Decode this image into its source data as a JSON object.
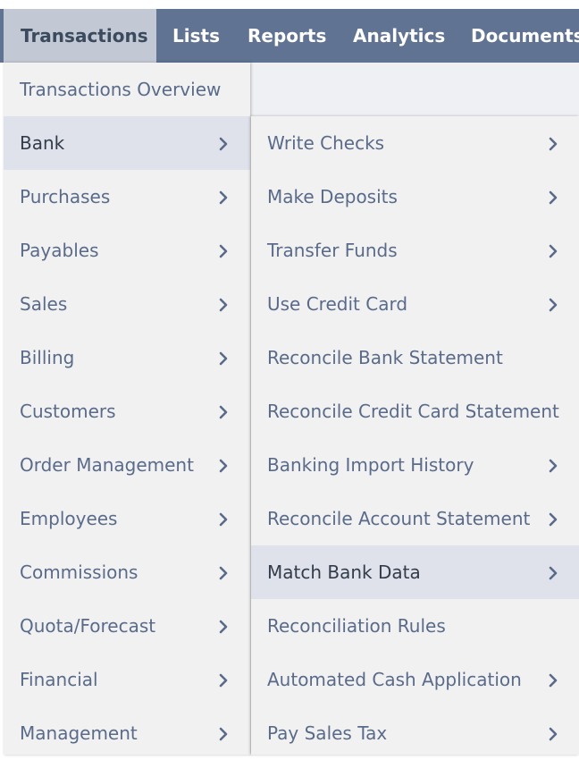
{
  "nav": {
    "tabs": [
      {
        "label": "Transactions",
        "active": true
      },
      {
        "label": "Lists",
        "active": false
      },
      {
        "label": "Reports",
        "active": false
      },
      {
        "label": "Analytics",
        "active": false
      },
      {
        "label": "Documents",
        "active": false
      }
    ]
  },
  "menu": {
    "items": [
      {
        "label": "Transactions Overview",
        "submenu": false
      },
      {
        "label": "Bank",
        "submenu": true,
        "highlighted": true
      },
      {
        "label": "Purchases",
        "submenu": true
      },
      {
        "label": "Payables",
        "submenu": true
      },
      {
        "label": "Sales",
        "submenu": true
      },
      {
        "label": "Billing",
        "submenu": true
      },
      {
        "label": "Customers",
        "submenu": true
      },
      {
        "label": "Order Management",
        "submenu": true
      },
      {
        "label": "Employees",
        "submenu": true
      },
      {
        "label": "Commissions",
        "submenu": true
      },
      {
        "label": "Quota/Forecast",
        "submenu": true
      },
      {
        "label": "Financial",
        "submenu": true
      },
      {
        "label": "Management",
        "submenu": true
      }
    ]
  },
  "submenu": {
    "items": [
      {
        "label": "Write Checks",
        "submenu": true
      },
      {
        "label": "Make Deposits",
        "submenu": true
      },
      {
        "label": "Transfer Funds",
        "submenu": true
      },
      {
        "label": "Use Credit Card",
        "submenu": true
      },
      {
        "label": "Reconcile Bank Statement",
        "submenu": false
      },
      {
        "label": "Reconcile Credit Card Statement",
        "submenu": false
      },
      {
        "label": "Banking Import History",
        "submenu": true
      },
      {
        "label": "Reconcile Account Statement",
        "submenu": true
      },
      {
        "label": "Match Bank Data",
        "submenu": true,
        "highlighted": true
      },
      {
        "label": "Reconciliation Rules",
        "submenu": false
      },
      {
        "label": "Automated Cash Application",
        "submenu": true
      },
      {
        "label": "Pay Sales Tax",
        "submenu": true
      }
    ]
  }
}
